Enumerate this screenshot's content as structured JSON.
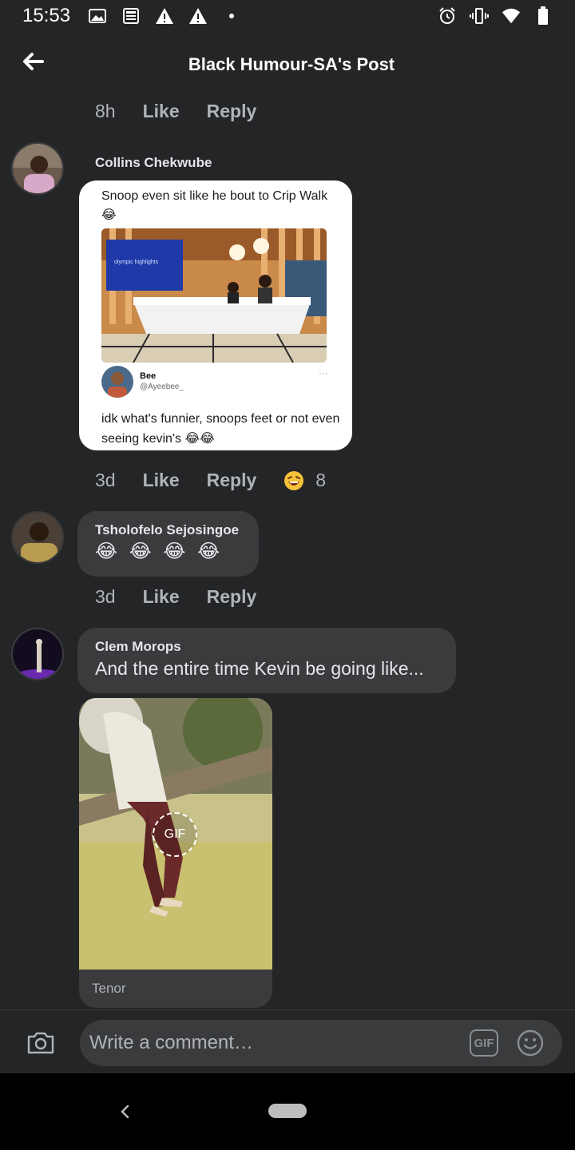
{
  "status_bar": {
    "time": "15:53",
    "left_icons": [
      "gallery-icon",
      "news-icon",
      "warning-icon",
      "warning-icon",
      "dot-icon"
    ],
    "right_icons": [
      "alarm-icon",
      "vibrate-icon",
      "wifi-icon",
      "battery-icon"
    ]
  },
  "header": {
    "title": "Black Humour-SA's Post",
    "back_icon": "arrow-left-icon"
  },
  "top_meta": {
    "time": "8h",
    "like": "Like",
    "reply": "Reply"
  },
  "comments": [
    {
      "author": "Collins Chekwube",
      "image": {
        "caption": "Snoop even sit like he bout to Crip Walk 😂",
        "tweet_name": "Bee",
        "tweet_handle": "@Ayeebee_",
        "tweet_more": "···",
        "tweet_text": "idk what's funnier, snoops feet or not even seeing kevin's 😂😂",
        "screen_text": "olympic highlights"
      },
      "time": "3d",
      "like": "Like",
      "reply": "Reply",
      "reaction_icon": "laughing-face-icon",
      "reaction_count": "8"
    },
    {
      "author": "Tsholofelo Sejosingoe",
      "text": "😂 😂 😂 😂",
      "time": "3d",
      "like": "Like",
      "reply": "Reply"
    },
    {
      "author": "Clem Morops",
      "text": "And the entire time Kevin be going like...",
      "gif_badge": "GIF",
      "gif_source": "Tenor"
    }
  ],
  "composer": {
    "placeholder": "Write a comment…",
    "gif_label": "GIF",
    "camera_icon": "camera-icon",
    "emoji_icon": "smiley-icon"
  },
  "colors": {
    "background": "#242527",
    "bubble": "#3a3b3c",
    "primary_text": "#e4e6eb",
    "secondary_text": "#b0b3b8"
  }
}
